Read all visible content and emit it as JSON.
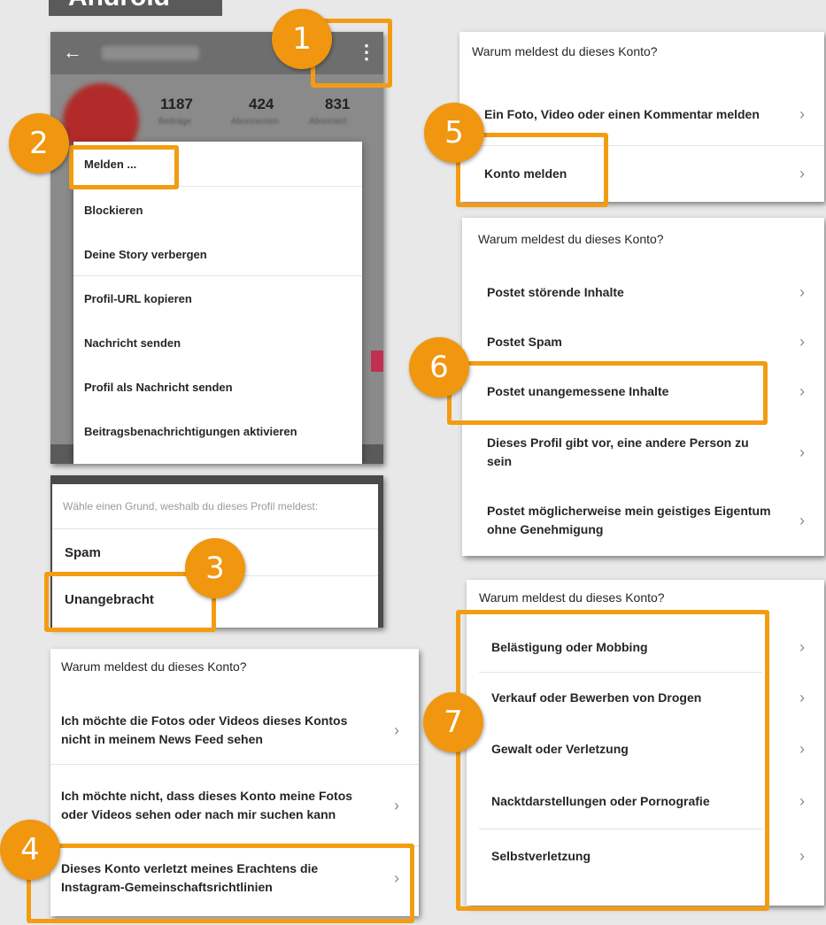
{
  "os_label": "Android",
  "profile_screen": {
    "back_icon": "arrow-left-icon",
    "username": "",
    "menu_icon": "vertical-dots-icon",
    "stats": [
      {
        "value": "1187",
        "label": "Beiträge"
      },
      {
        "value": "424",
        "label": "Abonnenten"
      },
      {
        "value": "831",
        "label": "Abonniert"
      }
    ],
    "menu_items": [
      "Melden ...",
      "Blockieren",
      "Deine Story verbergen",
      "Profil-URL kopieren",
      "Nachricht senden",
      "Profil als Nachricht senden",
      "Beitragsbenachrichtigungen aktivieren"
    ]
  },
  "reason_dialog": {
    "prompt": "Wähle einen Grund, weshalb du dieses Profil meldest:",
    "options": [
      "Spam",
      "Unangebracht"
    ]
  },
  "panel4": {
    "question": "Warum meldest du dieses Konto?",
    "options": [
      "Ich möchte die Fotos oder Videos dieses Kontos nicht in meinem News Feed sehen",
      "Ich möchte nicht, dass dieses Konto meine Fotos oder Videos sehen oder nach mir suchen kann",
      "Dieses Konto verletzt meines Erachtens die Instagram-Gemeinschaftsrichtlinien"
    ]
  },
  "panel5": {
    "question": "Warum meldest du dieses Konto?",
    "options": [
      "Ein Foto, Video oder einen Kommentar melden",
      "Konto melden"
    ]
  },
  "panel6": {
    "question": "Warum meldest du dieses Konto?",
    "options": [
      "Postet störende Inhalte",
      "Postet Spam",
      "Postet unangemessene Inhalte",
      "Dieses Profil gibt vor, eine andere Person zu sein",
      "Postet möglicherweise mein geistiges Eigentum ohne Genehmigung"
    ]
  },
  "panel7": {
    "question": "Warum meldest du dieses Konto?",
    "options": [
      "Belästigung oder Mobbing",
      "Verkauf oder Bewerben von Drogen",
      "Gewalt oder Verletzung",
      "Nacktdarstellungen oder Pornografie",
      "Selbstverletzung"
    ]
  },
  "chevron": "›",
  "step_badges": [
    "1",
    "2",
    "3",
    "4",
    "5",
    "6",
    "7"
  ],
  "colors": {
    "accent": "#f39c12",
    "badge": "#f0960f",
    "label_bg": "#5a5a5a"
  }
}
